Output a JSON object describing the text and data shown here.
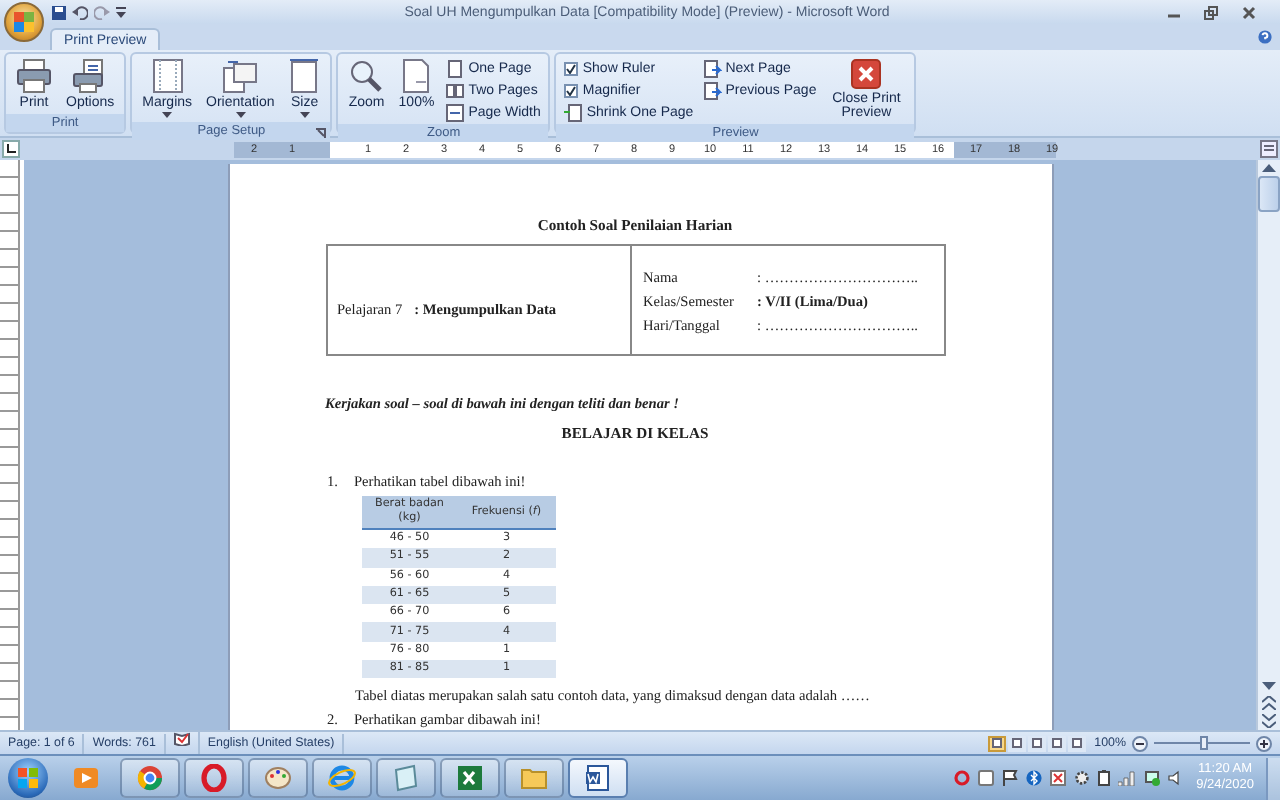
{
  "window": {
    "title": "Soal UH Mengumpulkan Data [Compatibility Mode] (Preview) - Microsoft Word"
  },
  "tabs": [
    {
      "label": "Print Preview",
      "selected": true
    }
  ],
  "ribbon": {
    "groups": [
      {
        "label": "Print",
        "launcher": false,
        "columns": [
          [
            {
              "kind": "large",
              "label": "Print",
              "has_menu": false
            }
          ],
          [
            {
              "kind": "large",
              "label": "Options",
              "has_menu": false
            }
          ]
        ]
      },
      {
        "label": "Page Setup",
        "launcher": true,
        "columns": [
          [
            {
              "kind": "large",
              "label": "Margins",
              "has_menu": true
            }
          ],
          [
            {
              "kind": "large",
              "label": "Orientation",
              "has_menu": true
            }
          ],
          [
            {
              "kind": "large",
              "label": "Size",
              "has_menu": true
            }
          ]
        ]
      },
      {
        "label": "Zoom",
        "launcher": false,
        "columns": [
          [
            {
              "kind": "large",
              "label": "Zoom",
              "has_menu": false
            }
          ],
          [
            {
              "kind": "large",
              "label": "100%",
              "has_menu": false
            }
          ],
          [
            {
              "kind": "small",
              "label": "One Page"
            },
            {
              "kind": "small",
              "label": "Two Pages"
            },
            {
              "kind": "small",
              "label": "Page Width"
            }
          ]
        ]
      },
      {
        "label": "Preview",
        "launcher": false,
        "columns": [
          [
            {
              "kind": "check",
              "label": "Show Ruler",
              "checked": true
            },
            {
              "kind": "check",
              "label": "Magnifier",
              "checked": true
            },
            {
              "kind": "small",
              "label": "Shrink One Page"
            }
          ],
          [
            {
              "kind": "small",
              "label": "Next Page"
            },
            {
              "kind": "small",
              "label": "Previous Page"
            }
          ],
          [
            {
              "kind": "large",
              "label": "Close Print Preview",
              "has_menu": false
            }
          ]
        ]
      }
    ]
  },
  "ruler": {
    "left_numbers": [
      "2",
      "1"
    ],
    "numbers": [
      "1",
      "2",
      "3",
      "4",
      "5",
      "6",
      "7",
      "8",
      "9",
      "10",
      "11",
      "12",
      "13",
      "14",
      "15",
      "16",
      "17",
      "18",
      "19"
    ]
  },
  "document": {
    "heading": "Contoh Soal Penilaian Harian",
    "info_table": {
      "subject_label": "Pelajaran 7",
      "subject_value": ": Mengumpulkan Data",
      "fields": [
        {
          "label": "Nama",
          "value": ": …………………………..",
          "bold": false
        },
        {
          "label": "Kelas/Semester",
          "value": ": V/II (Lima/Dua)",
          "bold": true
        },
        {
          "label": "Hari/Tanggal",
          "value": ": …………………………..",
          "bold": false
        }
      ]
    },
    "instruction": "Kerjakan soal – soal di bawah ini dengan teliti dan benar !",
    "section": "BELAJAR DI KELAS",
    "questions": [
      {
        "number": "1.",
        "text": "Perhatikan tabel  dibawah ini!",
        "table": {
          "columns": [
            "Berat badan (kg)",
            "Frekuensi (*f*)"
          ],
          "rows": [
            [
              "46 - 50",
              "3"
            ],
            [
              "51 - 55",
              "2"
            ],
            [
              "56 - 60",
              "4"
            ],
            [
              "61 - 65",
              "5"
            ],
            [
              "66 - 70",
              "6"
            ],
            [
              "71 - 75",
              "4"
            ],
            [
              "76 - 80",
              "1"
            ],
            [
              "81 - 85",
              "1"
            ]
          ]
        },
        "after": "Tabel diatas merupakan salah satu contoh data, yang dimaksud dengan data adalah ……"
      },
      {
        "number": "2.",
        "text": "Perhatikan gambar dibawah ini!"
      }
    ]
  },
  "status_bar": {
    "page": "Page: 1 of 6",
    "words": "Words: 761",
    "language": "English (United States)",
    "views": [
      {
        "selected": true
      },
      {
        "selected": false
      },
      {
        "selected": false
      },
      {
        "selected": false
      },
      {
        "selected": false
      }
    ],
    "zoom": "100%",
    "zoom_slider": {
      "level": 0.52
    }
  },
  "taskbar": {
    "buttons": [
      {
        "selected": false
      },
      {
        "selected": false
      },
      {
        "selected": false
      },
      {
        "selected": false
      },
      {
        "selected": false
      },
      {
        "selected": false
      },
      {
        "selected": false
      },
      {
        "selected": false
      },
      {
        "selected": true
      }
    ],
    "time": "11:20 AM",
    "date": "9/24/2020"
  }
}
